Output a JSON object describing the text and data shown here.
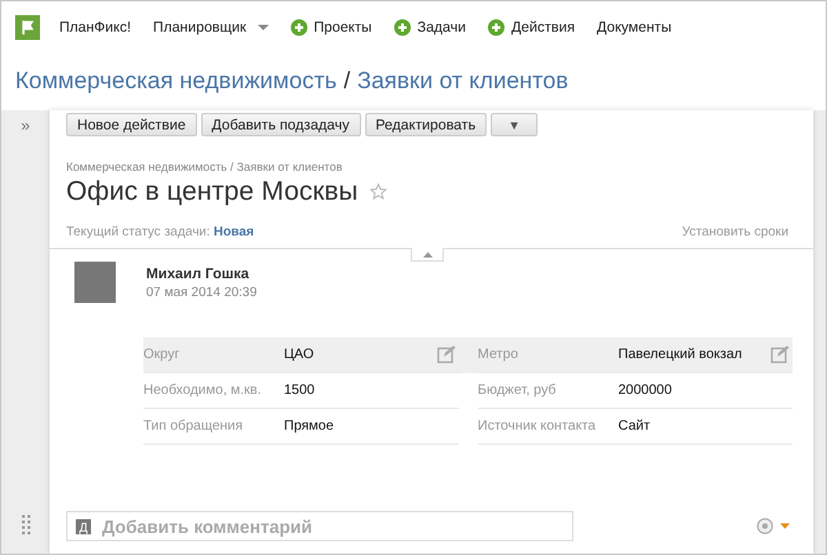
{
  "nav": {
    "items": [
      {
        "label": "ПланФикс!",
        "kind": "plain"
      },
      {
        "label": "Планировщик",
        "kind": "dropdown"
      },
      {
        "label": "Проекты",
        "kind": "add"
      },
      {
        "label": "Задачи",
        "kind": "add"
      },
      {
        "label": "Действия",
        "kind": "add"
      },
      {
        "label": "Документы",
        "kind": "plain"
      }
    ]
  },
  "page_title": {
    "project": "Коммерческая недвижимость",
    "separator": "/",
    "list": "Заявки от клиентов"
  },
  "sidebar": {
    "toggle": "»"
  },
  "toolbar": {
    "buttons": [
      {
        "label": "Новое действие",
        "kind": "text"
      },
      {
        "label": "Добавить подзадачу",
        "kind": "text"
      },
      {
        "label": "Редактировать",
        "kind": "text"
      },
      {
        "label": "▼",
        "kind": "menu"
      }
    ]
  },
  "task": {
    "breadcrumb": "Коммерческая недвижимость / Заявки от клиентов",
    "title": "Офис в центре Москвы",
    "starred": false,
    "status_label": "Текущий статус задачи:",
    "status": "Новая",
    "deadline_link": "Установить сроки"
  },
  "author": {
    "name": "Михаил Гошка",
    "date": "07 мая 2014 20:39"
  },
  "fields": [
    {
      "highlighted": true,
      "cells": [
        {
          "label": "Округ",
          "value": "ЦАО",
          "edit_icon": true
        },
        {
          "label": "Метро",
          "value": "Павелецкий вокзал",
          "edit_icon": true
        }
      ]
    },
    {
      "highlighted": false,
      "cells": [
        {
          "label": "Необходимо, м.кв.",
          "value": "1500",
          "edit_icon": false
        },
        {
          "label": "Бюджет, руб",
          "value": "2000000",
          "edit_icon": false
        }
      ]
    },
    {
      "highlighted": false,
      "cells": [
        {
          "label": "Тип обращения",
          "value": "Прямое",
          "edit_icon": false
        },
        {
          "label": "Источник контакта",
          "value": "Сайт",
          "edit_icon": false
        }
      ]
    }
  ],
  "comment": {
    "badge": "Д",
    "placeholder": "Добавить комментарий"
  }
}
